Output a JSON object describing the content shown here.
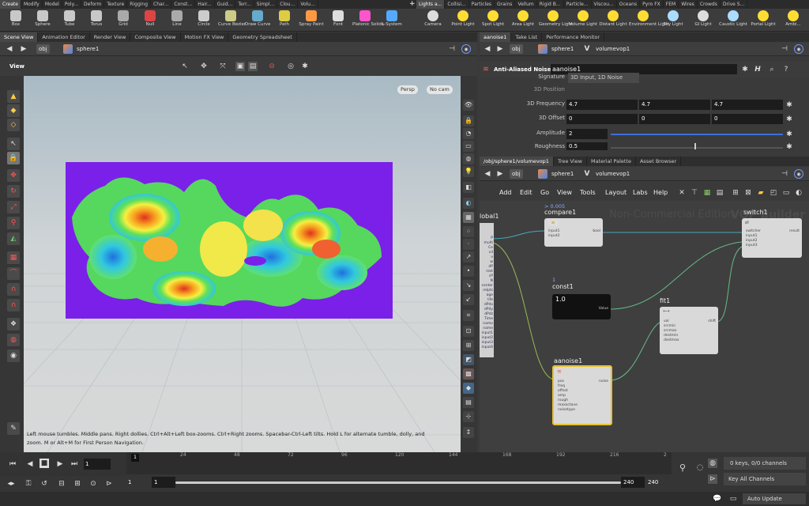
{
  "shelf_tabs_left": [
    "Create",
    "Modify",
    "Model",
    "Poly...",
    "Deform",
    "Texture",
    "Rigging",
    "Char...",
    "Const...",
    "Hair...",
    "Guid...",
    "Terr...",
    "Simpl...",
    "Clou...",
    "Volu..."
  ],
  "shelf_tabs_right": [
    "Lights a...",
    "Collisi...",
    "Particles",
    "Grains",
    "Vellum",
    "Rigid B...",
    "Particle...",
    "Viscou...",
    "Oceans",
    "Pyro FX",
    "FEM",
    "Wires",
    "Crowds",
    "Drive S..."
  ],
  "shelf_tools_left": [
    "Box",
    "Sphere",
    "Tube",
    "Torus",
    "Grid",
    "Null",
    "Line",
    "Circle",
    "Curve Bezier",
    "Draw Curve",
    "Path",
    "Spray Paint",
    "Font",
    "Platonic Solids",
    "L-System"
  ],
  "shelf_tools_right": [
    "Camera",
    "Point Light",
    "Spot Light",
    "Area Light",
    "Geometry Light",
    "Volume Light",
    "Distant Light",
    "Environment Light",
    "Sky Light",
    "GI Light",
    "Caustic Light",
    "Portal Light",
    "Ambi..."
  ],
  "left_pane_tabs": [
    "Scene View",
    "Animation Editor",
    "Render View",
    "Composite View",
    "Motion FX View",
    "Geometry Spreadsheet"
  ],
  "left_path": {
    "obj": "obj",
    "node": "sphere1"
  },
  "viewport": {
    "title": "View",
    "persp": "Persp",
    "cam": "No cam",
    "hint_line1": "Left mouse tumbles. Middle pans. Right dollies. Ctrl+Alt+Left box-zooms. Ctrl+Right zooms. Spacebar-Ctrl-Left tilts. Hold L for alternate tumble, dolly, and",
    "hint_line2": "zoom.     M or Alt+M for First Person Navigation."
  },
  "right_top_tabs": [
    "aanoise1",
    "Take List",
    "Performance Monitor"
  ],
  "right_top_path": {
    "obj": "obj",
    "node": "sphere1",
    "vop": "volumevop1"
  },
  "parm": {
    "type": "Anti-Aliased Noise",
    "name": "aanoise1",
    "signature": "3D Input, 1D Noise",
    "rows": [
      {
        "label": "Signature",
        "v1": "3D Input, 1D Noise"
      },
      {
        "label": "3D Position",
        "v1": ""
      },
      {
        "label": "3D Frequency",
        "v1": "4.7",
        "v2": "4.7",
        "v3": "4.7"
      },
      {
        "label": "3D Offset",
        "v1": "0",
        "v2": "0",
        "v3": "0"
      },
      {
        "label": "Amplitude",
        "v1": "2"
      },
      {
        "label": "Roughness",
        "v1": "0.5"
      }
    ]
  },
  "right_bottom_tabs": [
    "/obj/sphere1/volumevop1",
    "Tree View",
    "Material Palette",
    "Asset Browser"
  ],
  "net_path": {
    "obj": "obj",
    "node": "sphere1",
    "vop": "volumevop1"
  },
  "net_menu": [
    "Add",
    "Edit",
    "Go",
    "View",
    "Tools",
    "Layout",
    "Labs",
    "Help"
  ],
  "net": {
    "watermark": "Non-Commercial Edition",
    "watermark2": "VOP Builder",
    "global_label": "lobal1",
    "compare": {
      "name": "compare1",
      "value": "> 0.005",
      "inputs": [
        "input1",
        "input2"
      ],
      "output": "bool"
    },
    "switch": {
      "name": "switch1",
      "inputs": [
        "switcher",
        "input1",
        "input2",
        "input3"
      ],
      "output": "result"
    },
    "const": {
      "name": "const1",
      "index": "1",
      "value": "1.0",
      "output": "Value"
    },
    "fit": {
      "name": "fit1",
      "inputs": [
        "val",
        "srcmin",
        "srcmax",
        "destmin",
        "destmax"
      ],
      "output": "shift"
    },
    "aanoise": {
      "name": "aanoise1",
      "inputs": [
        "pos",
        "freq",
        "offset",
        "amp",
        "rough",
        "maxoctave",
        "noisetype"
      ],
      "output": "noise"
    },
    "global_ports": [
      "P",
      "multi",
      "Ce",
      "cd",
      "v",
      "w",
      "dP",
      "rest",
      "cP",
      "N",
      "center",
      "relpts",
      "age",
      "life",
      "dPdx",
      "dPdy",
      "dPdz",
      "Time",
      "namo",
      "name",
      "input1",
      "input2",
      "input3",
      "input4"
    ]
  },
  "timeline": {
    "frame": "1",
    "ticks": [
      "1",
      "24",
      "48",
      "72",
      "96",
      "120",
      "144",
      "168",
      "192",
      "216",
      "2"
    ],
    "start": "1",
    "range_start": "1",
    "range_end": "240",
    "end": "240",
    "keys": "0 keys, 0/0 channels",
    "key_all": "Key All Channels",
    "auto_update": "Auto Update"
  }
}
